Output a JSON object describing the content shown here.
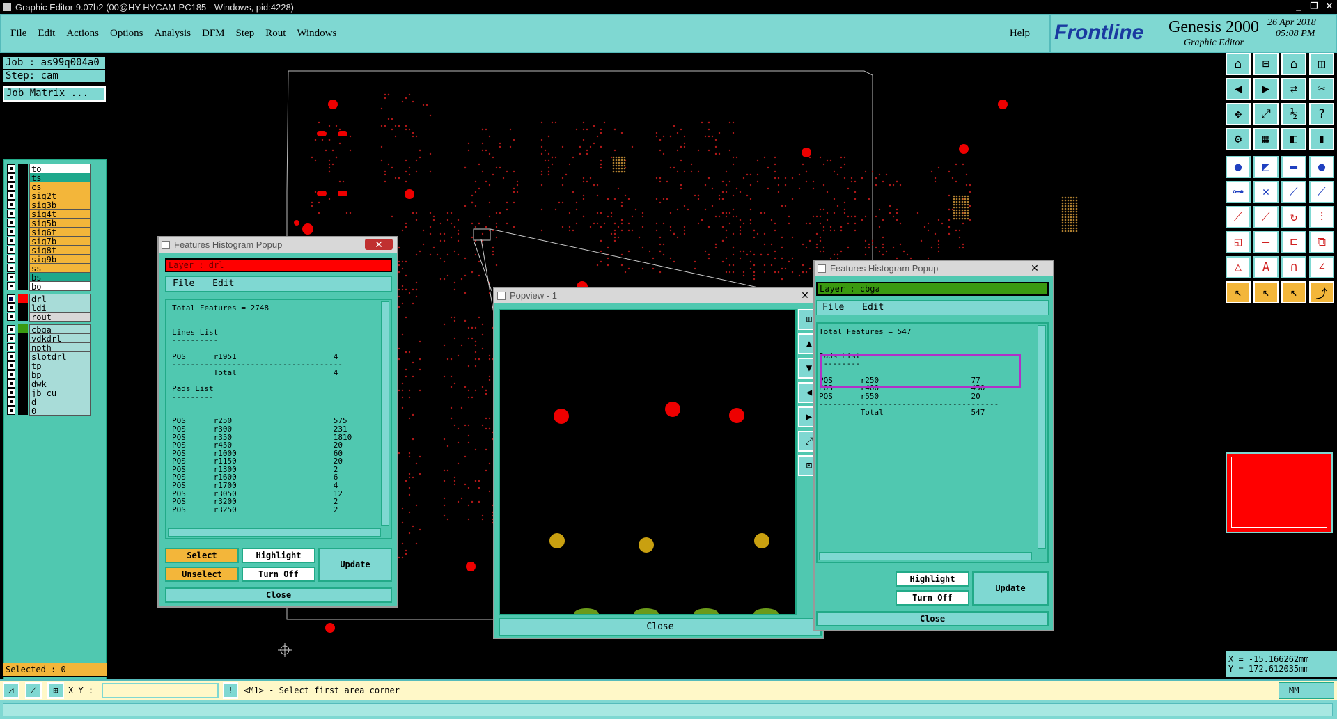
{
  "window": {
    "title": "Graphic Editor 9.07b2 (00@HY-HYCAM-PC185 - Windows, pid:4228)"
  },
  "menu": [
    "File",
    "Edit",
    "Actions",
    "Options",
    "Analysis",
    "DFM",
    "Step",
    "Rout",
    "Windows"
  ],
  "help_label": "Help",
  "logo": {
    "brand": "Frontline",
    "product": "Genesis 2000",
    "subtitle": "Graphic Editor",
    "date": "26 Apr 2018",
    "time": "05:08 PM"
  },
  "job": {
    "job_label": "Job : as99q004a0",
    "step_label": "Step: cam",
    "matrix_label": "Job Matrix ..."
  },
  "layers": [
    {
      "name": "to",
      "color": "#ffffff"
    },
    {
      "name": "ts",
      "color": "#1ea88c"
    },
    {
      "name": "cs",
      "color": "#f3b63a"
    },
    {
      "name": "sig2t",
      "color": "#f3b63a"
    },
    {
      "name": "sig3b",
      "color": "#f3b63a"
    },
    {
      "name": "sig4t",
      "color": "#f3b63a"
    },
    {
      "name": "sig5b",
      "color": "#f3b63a"
    },
    {
      "name": "sig6t",
      "color": "#f3b63a"
    },
    {
      "name": "sig7b",
      "color": "#f3b63a"
    },
    {
      "name": "sig8t",
      "color": "#f3b63a"
    },
    {
      "name": "sig9b",
      "color": "#f3b63a"
    },
    {
      "name": "ss",
      "color": "#f3b63a"
    },
    {
      "name": "bs",
      "color": "#1ea88c"
    },
    {
      "name": "bo",
      "color": "#ffffff"
    },
    {
      "name": "drl",
      "color": "#a8dcd8"
    },
    {
      "name": "ldi",
      "color": "#a8dcd8"
    },
    {
      "name": "rout",
      "color": "#d8d8d8"
    },
    {
      "name": "cbga",
      "color": "#a8dcd8"
    },
    {
      "name": "ydkdrl",
      "color": "#a8dcd8"
    },
    {
      "name": "npth",
      "color": "#a8dcd8"
    },
    {
      "name": "slotdrl",
      "color": "#a8dcd8"
    },
    {
      "name": "tp",
      "color": "#a8dcd8"
    },
    {
      "name": "bp",
      "color": "#a8dcd8"
    },
    {
      "name": "dwk",
      "color": "#a8dcd8"
    },
    {
      "name": "jb_cu",
      "color": "#a8dcd8"
    },
    {
      "name": "d",
      "color": "#a8dcd8"
    },
    {
      "name": "0",
      "color": "#a8dcd8"
    }
  ],
  "selected_label": "Selected : 0",
  "hist1": {
    "title": "Features Histogram Popup",
    "layer": "Layer :  drl",
    "menu": [
      "File",
      "Edit"
    ],
    "body": "Total Features = 2748\n\n\nLines List\n----------\n\nPOS      r1951                     4\n-------------------------------------\n         Total                     4\n\nPads List\n---------\n\n\nPOS      r250                      575\nPOS      r300                      231\nPOS      r350                      1810\nPOS      r450                      20\nPOS      r1000                     60\nPOS      r1150                     20\nPOS      r1300                     2\nPOS      r1600                     6\nPOS      r1700                     4\nPOS      r3050                     12\nPOS      r3200                     2\nPOS      r3250                     2",
    "select": "Select",
    "unselect": "Unselect",
    "highlight": "Highlight",
    "turnoff": "Turn Off",
    "update": "Update",
    "close": "Close"
  },
  "hist2": {
    "title": "Features Histogram Popup",
    "layer": "Layer :  cbga",
    "menu": [
      "File",
      "Edit"
    ],
    "body": "Total Features = 547\n\n\nPads List\n---------\n\nPOS      r250                    77\nPOS      r400                    450\nPOS      r550                    20\n---------------------------------------\n         Total                   547",
    "highlight": "Highlight",
    "turnoff": "Turn Off",
    "update": "Update",
    "close": "Close"
  },
  "popview": {
    "title": "Popview - 1",
    "close": "Close"
  },
  "coords": {
    "x": "X  =  -15.166262mm",
    "y": "Y  =  172.612035mm",
    "units": "MM"
  },
  "status": {
    "xy_label": "X Y :",
    "xy_value": "",
    "message": "<M1> - Select first area corner"
  }
}
